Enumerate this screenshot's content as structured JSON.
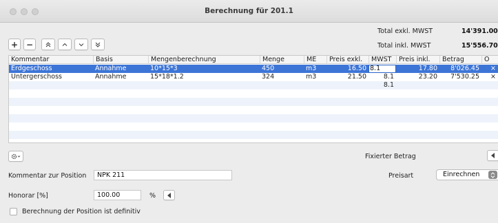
{
  "window": {
    "title": "Berechnung für 201.1"
  },
  "toolbar": {
    "add": "+",
    "remove": "−"
  },
  "totals": {
    "excl_label": "Total exkl. MWST",
    "excl_value": "14'391.00",
    "incl_label": "Total inkl. MWST",
    "incl_value": "15'556.70"
  },
  "table": {
    "columns": [
      "Kommentar",
      "Basis",
      "Mengenberechnung",
      "Menge",
      "ME",
      "Preis exkl.",
      "MWST",
      "Preis inkl.",
      "Betrag",
      "O"
    ],
    "rows": [
      {
        "kommentar": "Erdgeschoss",
        "basis": "Annahme",
        "mengenberechnung": "10*15*3",
        "menge": "450",
        "me": "m3",
        "preis_exkl": "16.50",
        "mwst": "8.1",
        "preis_inkl": "17.80",
        "betrag": "8'026.45",
        "o": "×"
      },
      {
        "kommentar": "Untergerschoss",
        "basis": "Annahme",
        "mengenberechnung": "15*18*1.2",
        "menge": "324",
        "me": "m3",
        "preis_exkl": "21.50",
        "mwst": "8.1",
        "preis_inkl": "23.20",
        "betrag": "7'530.25",
        "o": "×"
      },
      {
        "kommentar": "",
        "basis": "",
        "mengenberechnung": "",
        "menge": "",
        "me": "",
        "preis_exkl": "",
        "mwst": "8.1",
        "preis_inkl": "",
        "betrag": "",
        "o": ""
      }
    ]
  },
  "bottom": {
    "fixed_amount_label": "Fixierter Betrag",
    "comment_label": "Kommentar zur Position",
    "comment_value": "NPK 211",
    "price_type_label": "Preisart",
    "price_type_value": "Einrechnen",
    "honorar_label": "Honorar [%]",
    "honorar_value": "100.00",
    "percent_sign": "%",
    "definitive_label": "Berechnung der Position ist definitiv"
  },
  "colors": {
    "selection": "#3d75d6",
    "alt_row": "#eef3fb"
  }
}
